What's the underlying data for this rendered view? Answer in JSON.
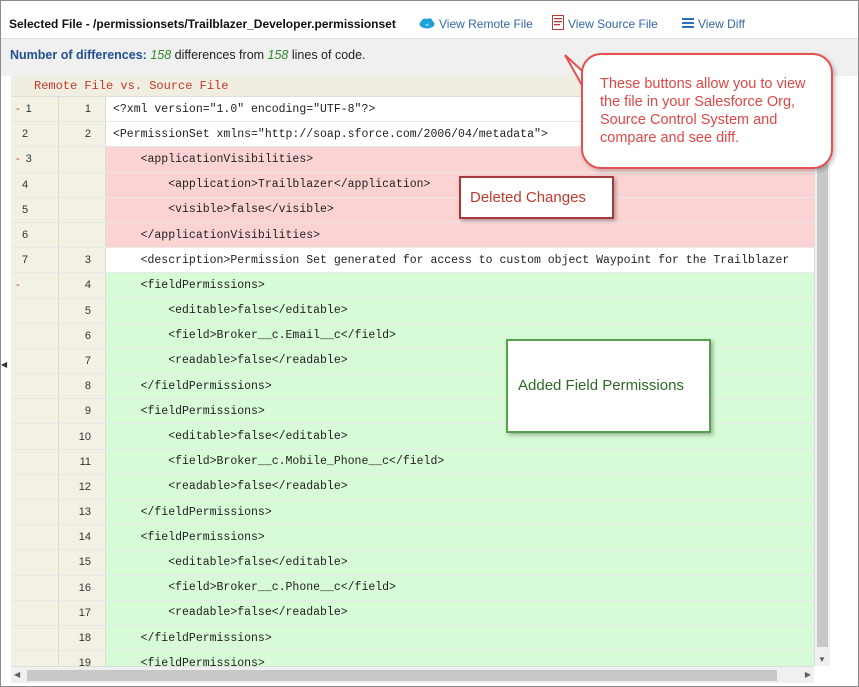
{
  "header": {
    "selected_file_label": "Selected File -",
    "selected_file_path": "/permissionsets/Trailblazer_Developer.permissionset",
    "view_remote_label": "View Remote File",
    "view_source_label": "View Source File",
    "view_diff_label": "View Diff",
    "remote_icon": "cloud-icon",
    "source_icon": "document-icon",
    "diff_icon": "list-icon"
  },
  "info": {
    "label": "Number of differences",
    "diff_count": "158",
    "text_mid": " differences from ",
    "lines_count": "158",
    "text_end": " lines of code."
  },
  "diff": {
    "heading": "Remote File vs. Source File",
    "rows": [
      {
        "left": "1",
        "mark": "-",
        "right": "1",
        "code": "<?xml version=\"1.0\" encoding=\"UTF-8\"?>",
        "type": "same"
      },
      {
        "left": "2",
        "mark": "",
        "right": "2",
        "code": "<PermissionSet xmlns=\"http://soap.sforce.com/2006/04/metadata\">",
        "type": "same"
      },
      {
        "left": "3",
        "mark": "-",
        "right": "",
        "code": "    <applicationVisibilities>",
        "type": "deleted"
      },
      {
        "left": "4",
        "mark": "",
        "right": "",
        "code": "        <application>Trailblazer</application>",
        "type": "deleted"
      },
      {
        "left": "5",
        "mark": "",
        "right": "",
        "code": "        <visible>false</visible>",
        "type": "deleted"
      },
      {
        "left": "6",
        "mark": "",
        "right": "",
        "code": "    </applicationVisibilities>",
        "type": "deleted"
      },
      {
        "left": "7",
        "mark": "",
        "right": "3",
        "code": "    <description>Permission Set generated for access to custom object Waypoint for the Trailblazer",
        "type": "same"
      },
      {
        "left": "",
        "mark": "-",
        "right": "4",
        "code": "    <fieldPermissions>",
        "type": "added"
      },
      {
        "left": "",
        "mark": "",
        "right": "5",
        "code": "        <editable>false</editable>",
        "type": "added"
      },
      {
        "left": "",
        "mark": "",
        "right": "6",
        "code": "        <field>Broker__c.Email__c</field>",
        "type": "added"
      },
      {
        "left": "",
        "mark": "",
        "right": "7",
        "code": "        <readable>false</readable>",
        "type": "added"
      },
      {
        "left": "",
        "mark": "",
        "right": "8",
        "code": "    </fieldPermissions>",
        "type": "added"
      },
      {
        "left": "",
        "mark": "",
        "right": "9",
        "code": "    <fieldPermissions>",
        "type": "added"
      },
      {
        "left": "",
        "mark": "",
        "right": "10",
        "code": "        <editable>false</editable>",
        "type": "added"
      },
      {
        "left": "",
        "mark": "",
        "right": "11",
        "code": "        <field>Broker__c.Mobile_Phone__c</field>",
        "type": "added"
      },
      {
        "left": "",
        "mark": "",
        "right": "12",
        "code": "        <readable>false</readable>",
        "type": "added"
      },
      {
        "left": "",
        "mark": "",
        "right": "13",
        "code": "    </fieldPermissions>",
        "type": "added"
      },
      {
        "left": "",
        "mark": "",
        "right": "14",
        "code": "    <fieldPermissions>",
        "type": "added"
      },
      {
        "left": "",
        "mark": "",
        "right": "15",
        "code": "        <editable>false</editable>",
        "type": "added"
      },
      {
        "left": "",
        "mark": "",
        "right": "16",
        "code": "        <field>Broker__c.Phone__c</field>",
        "type": "added"
      },
      {
        "left": "",
        "mark": "",
        "right": "17",
        "code": "        <readable>false</readable>",
        "type": "added"
      },
      {
        "left": "",
        "mark": "",
        "right": "18",
        "code": "    </fieldPermissions>",
        "type": "added"
      },
      {
        "left": "",
        "mark": "",
        "right": "19",
        "code": "    <fieldPermissions>",
        "type": "added"
      }
    ]
  },
  "annotations": {
    "buttons_note": "These buttons allow you to view the file in your Salesforce Org, Source Control System and compare and see diff.",
    "deleted_note": "Deleted Changes",
    "added_note": "Added Field Permissions"
  },
  "colors": {
    "deleted_bg": "#fcd3d3",
    "added_bg": "#d6fbd6",
    "link": "#3466a8",
    "count": "#2e8b2e"
  }
}
